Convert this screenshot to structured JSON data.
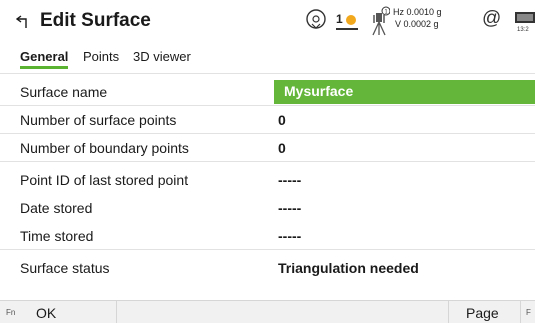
{
  "header": {
    "title": "Edit Surface",
    "hz_readout": "Hz 0.0010 g",
    "v_readout": "V 0.0002 g",
    "face_indicator": "1",
    "at_symbol": "@",
    "clock": "13:2",
    "icons": [
      "back-icon",
      "level-bubble-icon",
      "face-indicator-icon",
      "total-station-icon",
      "at-icon",
      "battery-icon"
    ]
  },
  "tabs": [
    {
      "label": "General",
      "active": true
    },
    {
      "label": "Points",
      "active": false
    },
    {
      "label": "3D viewer",
      "active": false
    }
  ],
  "fields": {
    "surface_name": {
      "label": "Surface name",
      "value": "Mysurface"
    },
    "num_surface_points": {
      "label": "Number of surface points",
      "value": "0"
    },
    "num_boundary_points": {
      "label": "Number of boundary points",
      "value": "0"
    },
    "last_point_id": {
      "label": "Point ID of last stored point",
      "value": "-----"
    },
    "date_stored": {
      "label": "Date stored",
      "value": "-----"
    },
    "time_stored": {
      "label": "Time stored",
      "value": "-----"
    },
    "surface_status": {
      "label": "Surface status",
      "value": "Triangulation needed"
    }
  },
  "softkeys": {
    "fn_left": "Fn",
    "ok": "OK",
    "page": "Page",
    "fn_right": "F"
  },
  "colors": {
    "accent": "#64b63a",
    "tab_underline": "#5ab331",
    "softbar_bg": "#f1f1f1"
  }
}
